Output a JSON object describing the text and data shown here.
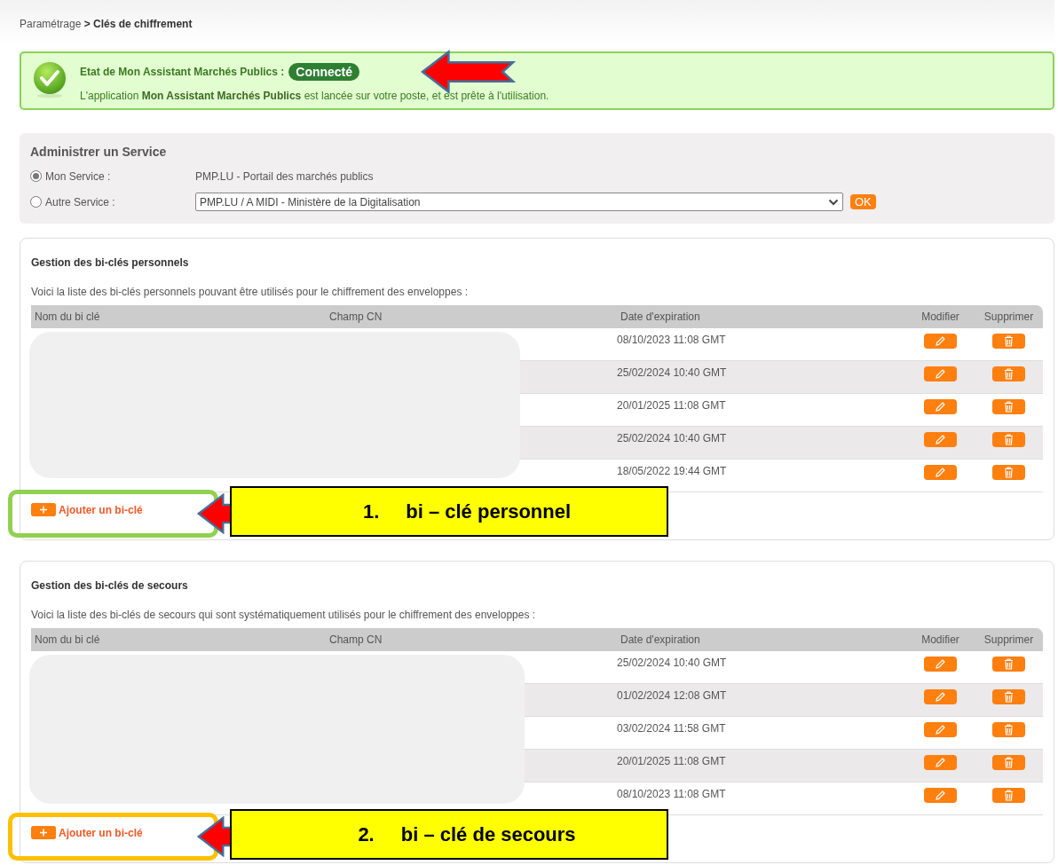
{
  "breadcrumb": {
    "parent": "Paramétrage",
    "separator": ">",
    "current": "Clés de chiffrement"
  },
  "status": {
    "label": "Etat de Mon Assistant Marchés Publics :",
    "value": "Connecté",
    "message": "L'application **Mon Assistant Marchés Publics** est lancée sur votre poste, et est prête à l'utilisation."
  },
  "service": {
    "title": "Administrer un Service",
    "options": [
      {
        "label": "Mon Service :",
        "selected": true,
        "kind": "text",
        "value": "PMP.LU - Portail des marchés publics"
      },
      {
        "label": "Autre Service :",
        "selected": false,
        "kind": "select",
        "value": "PMP.LU / A MIDI - Ministère de la Digitalisation",
        "button": "OK"
      }
    ]
  },
  "sections": [
    {
      "title": "Gestion des bi-clés personnels",
      "description": "Voici la liste des bi-clés personnels pouvant être utilisés pour le chiffrement des enveloppes :",
      "columns": [
        "Nom du bi clé",
        "Champ CN",
        "Date d'expiration",
        "Modifier",
        "Supprimer"
      ],
      "rows": [
        {
          "expiration": "08/10/2023 11:08 GMT"
        },
        {
          "expiration": "25/02/2024 10:40 GMT"
        },
        {
          "expiration": "20/01/2025 11:08 GMT"
        },
        {
          "expiration": "25/02/2024 10:40 GMT"
        },
        {
          "expiration": "18/05/2022 19:44 GMT"
        }
      ],
      "add_button": "Ajouter un bi-clé",
      "annotation": {
        "number": "1.",
        "text": "bi – clé personnel",
        "color": "#92d050"
      }
    },
    {
      "title": "Gestion des bi-clés de secours",
      "description": "Voici la liste des bi-clés de secours qui sont systématiquement utilisés pour le chiffrement des enveloppes :",
      "columns": [
        "Nom du bi clé",
        "Champ CN",
        "Date d'expiration",
        "Modifier",
        "Supprimer"
      ],
      "rows": [
        {
          "expiration": "25/02/2024 10:40 GMT"
        },
        {
          "expiration": "01/02/2024 12:08 GMT"
        },
        {
          "expiration": "03/02/2024 11:58 GMT"
        },
        {
          "expiration": "20/01/2025 11:08 GMT"
        },
        {
          "expiration": "08/10/2023 11:08 GMT"
        }
      ],
      "add_button": "Ajouter un bi-clé",
      "annotation": {
        "number": "2.",
        "text": "bi – clé de secours",
        "color": "#ffc000"
      }
    }
  ]
}
